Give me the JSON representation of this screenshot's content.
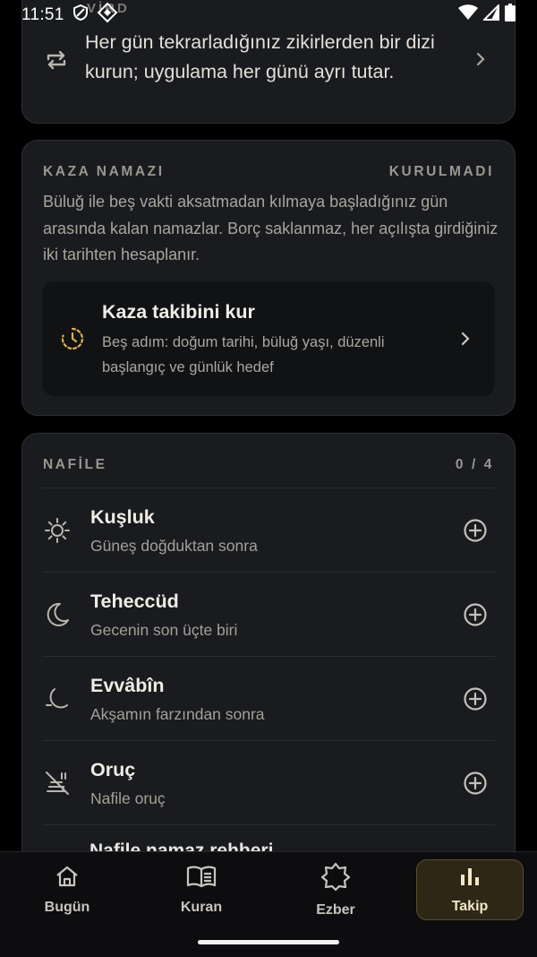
{
  "status_bar": {
    "time": "11:51"
  },
  "vird": {
    "label": "VİRD",
    "text": "Her gün tekrarladığınız zikirlerden bir dizi kurun; uygulama her günü ayrı tutar."
  },
  "kaza": {
    "heading": "KAZA NAMAZI",
    "status": "KURULMADI",
    "description": "Büluğ ile beş vakti aksatmadan kılmaya başladığınız gün arasında kalan namazlar. Borç saklanmaz, her açılışta girdiğiniz iki tarihten hesaplanır.",
    "setup_title": "Kaza takibini kur",
    "setup_subtitle": "Beş adım: doğum tarihi, büluğ yaşı, düzenli başlangıç ve günlük hedef"
  },
  "nafile": {
    "heading": "NAFİLE",
    "count": "0 / 4",
    "items": [
      {
        "title": "Kuşluk",
        "subtitle": "Güneş doğduktan sonra",
        "icon": "sun-icon"
      },
      {
        "title": "Teheccüd",
        "subtitle": "Gecenin son üçte biri",
        "icon": "moon-icon"
      },
      {
        "title": "Evvâbîn",
        "subtitle": "Akşamın farzından sonra",
        "icon": "night-moon-icon"
      },
      {
        "title": "Oruç",
        "subtitle": "Nafile oruç",
        "icon": "no-food-icon"
      }
    ],
    "peek_item": "Nafile namaz rehberi"
  },
  "bottom_nav": {
    "items": [
      {
        "label": "Bugün",
        "icon": "home-icon"
      },
      {
        "label": "Kuran",
        "icon": "book-icon"
      },
      {
        "label": "Ezber",
        "icon": "star-icon"
      },
      {
        "label": "Takip",
        "icon": "chart-icon"
      }
    ],
    "active": "Takip"
  },
  "colors": {
    "background": "#000000",
    "card": "#1a1b1e",
    "accent": "#e0b13c",
    "active_tab": "#2e2716"
  }
}
